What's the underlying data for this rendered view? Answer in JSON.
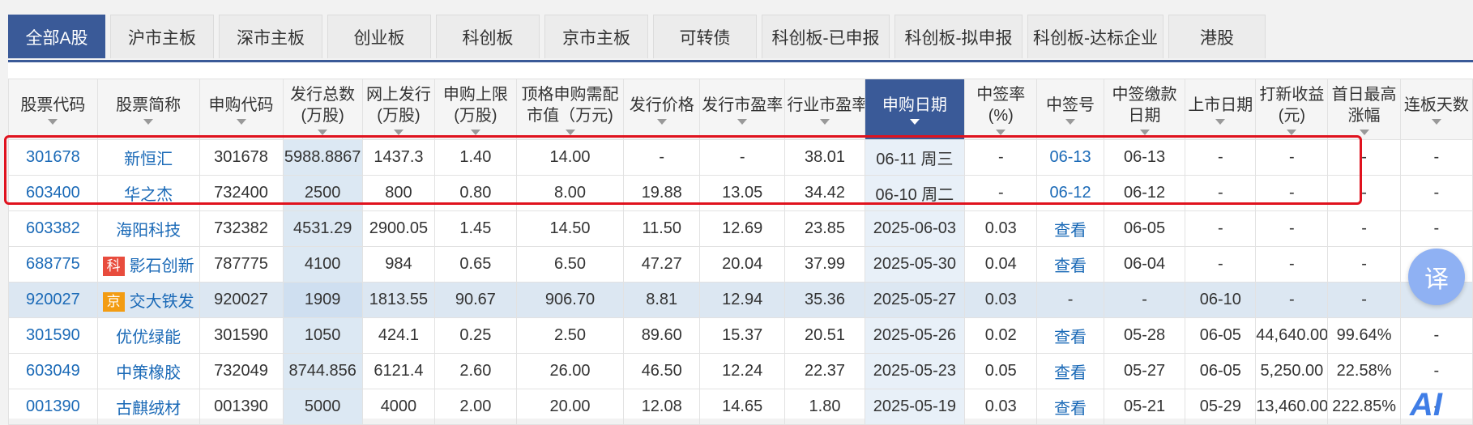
{
  "tabs": [
    "全部A股",
    "沪市主板",
    "深市主板",
    "创业板",
    "科创板",
    "京市主板",
    "可转债",
    "科创板-已申报",
    "科创板-拟申报",
    "科创板-达标企业",
    "港股"
  ],
  "active_tab": 0,
  "headers": [
    "股票代码",
    "股票简称",
    "申购代码",
    "发行总数\n(万股)",
    "网上发行\n(万股)",
    "申购上限\n(万股)",
    "顶格申购需配\n市值（万元)",
    "发行价格",
    "发行市盈率",
    "行业市盈率",
    "申购日期",
    "中签率\n(%)",
    "中签号",
    "中签缴款\n日期",
    "上市日期",
    "打新收益\n(元)",
    "首日最高\n涨幅",
    "连板天数"
  ],
  "sorted_column": 10,
  "rows": [
    {
      "code": "301678",
      "name": "新恒汇",
      "tag": "",
      "sub": "301678",
      "total": "5988.8867",
      "online": "1437.3",
      "limit": "1.40",
      "cap": "14.00",
      "price": "-",
      "pe": "-",
      "ind_pe": "38.01",
      "date": "06-11 周三",
      "rate": "-",
      "lot": "06-13",
      "pay": "06-13",
      "list": "-",
      "profit": "-",
      "rise": "-",
      "boards": "-"
    },
    {
      "code": "603400",
      "name": "华之杰",
      "tag": "",
      "sub": "732400",
      "total": "2500",
      "online": "800",
      "limit": "0.80",
      "cap": "8.00",
      "price": "19.88",
      "pe": "13.05",
      "ind_pe": "34.42",
      "date": "06-10 周二",
      "rate": "-",
      "lot": "06-12",
      "pay": "06-12",
      "list": "-",
      "profit": "-",
      "rise": "-",
      "boards": "-"
    },
    {
      "code": "603382",
      "name": "海阳科技",
      "tag": "",
      "sub": "732382",
      "total": "4531.29",
      "online": "2900.05",
      "limit": "1.45",
      "cap": "14.50",
      "price": "11.50",
      "pe": "12.69",
      "ind_pe": "23.85",
      "date": "2025-06-03",
      "rate": "0.03",
      "lot": "查看",
      "pay": "06-05",
      "list": "-",
      "profit": "-",
      "rise": "-",
      "boards": "-"
    },
    {
      "code": "688775",
      "name": "影石创新",
      "tag": "科",
      "sub": "787775",
      "total": "4100",
      "online": "984",
      "limit": "0.65",
      "cap": "6.50",
      "price": "47.27",
      "pe": "20.04",
      "ind_pe": "37.99",
      "date": "2025-05-30",
      "rate": "0.04",
      "lot": "查看",
      "pay": "06-04",
      "list": "-",
      "profit": "-",
      "rise": "-",
      "boards": "-"
    },
    {
      "code": "920027",
      "name": "交大铁发",
      "tag": "京",
      "sub": "920027",
      "total": "1909",
      "online": "1813.55",
      "limit": "90.67",
      "cap": "906.70",
      "price": "8.81",
      "pe": "12.94",
      "ind_pe": "35.36",
      "date": "2025-05-27",
      "rate": "0.03",
      "lot": "-",
      "pay": "-",
      "list": "06-10",
      "profit": "-",
      "rise": "-",
      "boards": "-"
    },
    {
      "code": "301590",
      "name": "优优绿能",
      "tag": "",
      "sub": "301590",
      "total": "1050",
      "online": "424.1",
      "limit": "0.25",
      "cap": "2.50",
      "price": "89.60",
      "pe": "15.37",
      "ind_pe": "20.51",
      "date": "2025-05-26",
      "rate": "0.02",
      "lot": "查看",
      "pay": "05-28",
      "list": "06-05",
      "profit": "44,640.00",
      "rise": "99.64%",
      "boards": "-"
    },
    {
      "code": "603049",
      "name": "中策橡胶",
      "tag": "",
      "sub": "732049",
      "total": "8744.856",
      "online": "6121.4",
      "limit": "2.60",
      "cap": "26.00",
      "price": "46.50",
      "pe": "12.24",
      "ind_pe": "22.37",
      "date": "2025-05-23",
      "rate": "0.05",
      "lot": "查看",
      "pay": "05-27",
      "list": "06-05",
      "profit": "5,250.00",
      "rise": "22.58%",
      "boards": "-"
    },
    {
      "code": "001390",
      "name": "古麒绒材",
      "tag": "",
      "sub": "001390",
      "total": "5000",
      "online": "4000",
      "limit": "2.00",
      "cap": "20.00",
      "price": "12.08",
      "pe": "14.65",
      "ind_pe": "1.80",
      "date": "2025-05-19",
      "rate": "0.03",
      "lot": "查看",
      "pay": "05-21",
      "list": "05-29",
      "profit": "13,460.00",
      "rise": "222.85%",
      "boards": "-"
    }
  ],
  "highlight_row": 4,
  "translate_label": "译",
  "ai_label": "AI",
  "colors": {
    "accent": "#3a5a98",
    "link": "#1b6ab7",
    "red_box": "#e0121e"
  }
}
